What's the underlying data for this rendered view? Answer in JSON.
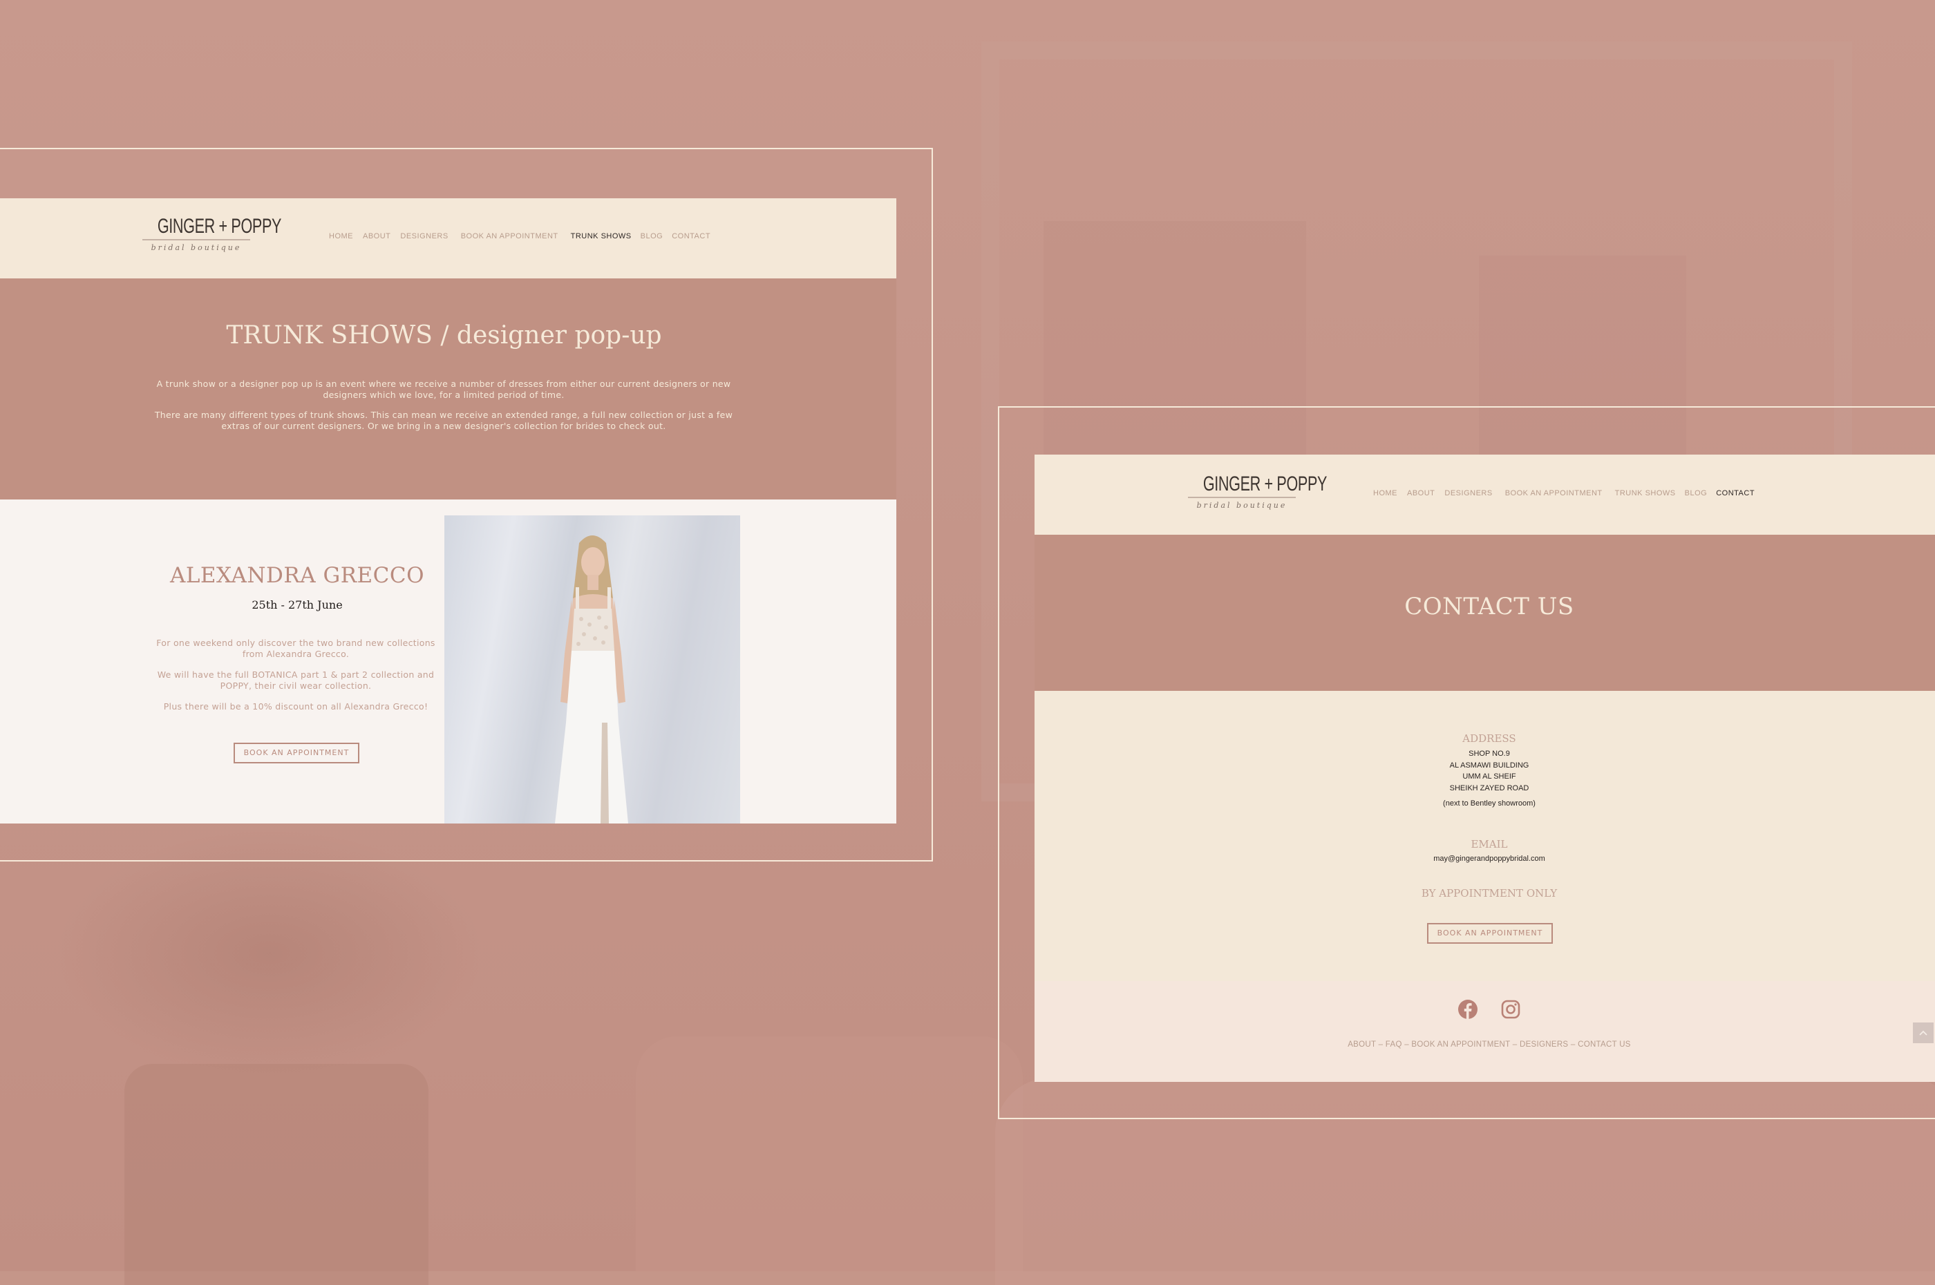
{
  "colors": {
    "background": "#c59689",
    "frame_line": "#f6ead9",
    "header_bg": "#f4e8d8",
    "hero_bg": "#c19183",
    "hero_text": "#f6ead9",
    "accent_rose": "#b98b7e",
    "nav_inactive": "#b89d8d",
    "nav_active": "#2f2826",
    "event_bg": "#f8f3f0",
    "footer_bg": "#f5e6dc"
  },
  "brand": {
    "name": "GINGER + POPPY",
    "tagline": "bridal  boutique"
  },
  "nav_items": [
    "HOME",
    "ABOUT",
    "DESIGNERS",
    "BOOK AN APPOINTMENT",
    "TRUNK SHOWS",
    "BLOG",
    "CONTACT"
  ],
  "trunk_page": {
    "active_nav": "TRUNK SHOWS",
    "hero": {
      "title": "TRUNK SHOWS / designer pop-up",
      "paragraph_1": "A trunk show or a designer pop up is an event where we receive a number of dresses from either our current designers or new designers which we love, for a limited period of time.",
      "paragraph_2": "There are many different types of trunk shows.  This can mean we receive an extended range, a full new collection or just a few extras of our current designers.  Or we bring in a new designer's collection for brides to check out."
    },
    "event": {
      "designer": "ALEXANDRA GRECCO",
      "dates": "25th - 27th June",
      "text_1": "For one weekend only discover the two brand new collections from Alexandra Grecco.",
      "text_2": "We will have the full BOTANICA part 1 & part 2 collection and POPPY, their civil wear collection.",
      "text_3": "Plus there will be a 10% discount on all Alexandra Grecco!",
      "button": "BOOK AN APPOINTMENT",
      "image_alt": "Model in white lace-bodice bridal gown with leg slit"
    }
  },
  "contact_page": {
    "active_nav": "CONTACT",
    "hero_title": "CONTACT US",
    "address_label": "ADDRESS",
    "address_lines": [
      "SHOP NO.9",
      "AL ASMAWI BUILDING",
      "UMM AL SHEIF",
      "SHEIKH ZAYED ROAD"
    ],
    "address_note": "(next to Bentley showroom)",
    "email_label": "EMAIL",
    "email": "may@gingerandpoppybridal.com",
    "appointment_note": "BY APPOINTMENT ONLY",
    "button": "BOOK AN APPOINTMENT",
    "social": [
      "facebook-icon",
      "instagram-icon"
    ],
    "footer_links": [
      "ABOUT",
      "FAQ",
      "BOOK AN APPOINTMENT",
      "DESIGNERS",
      "CONTACT US"
    ],
    "footer_separator": " – ",
    "scroll_top_icon": "chevron-up-icon"
  }
}
